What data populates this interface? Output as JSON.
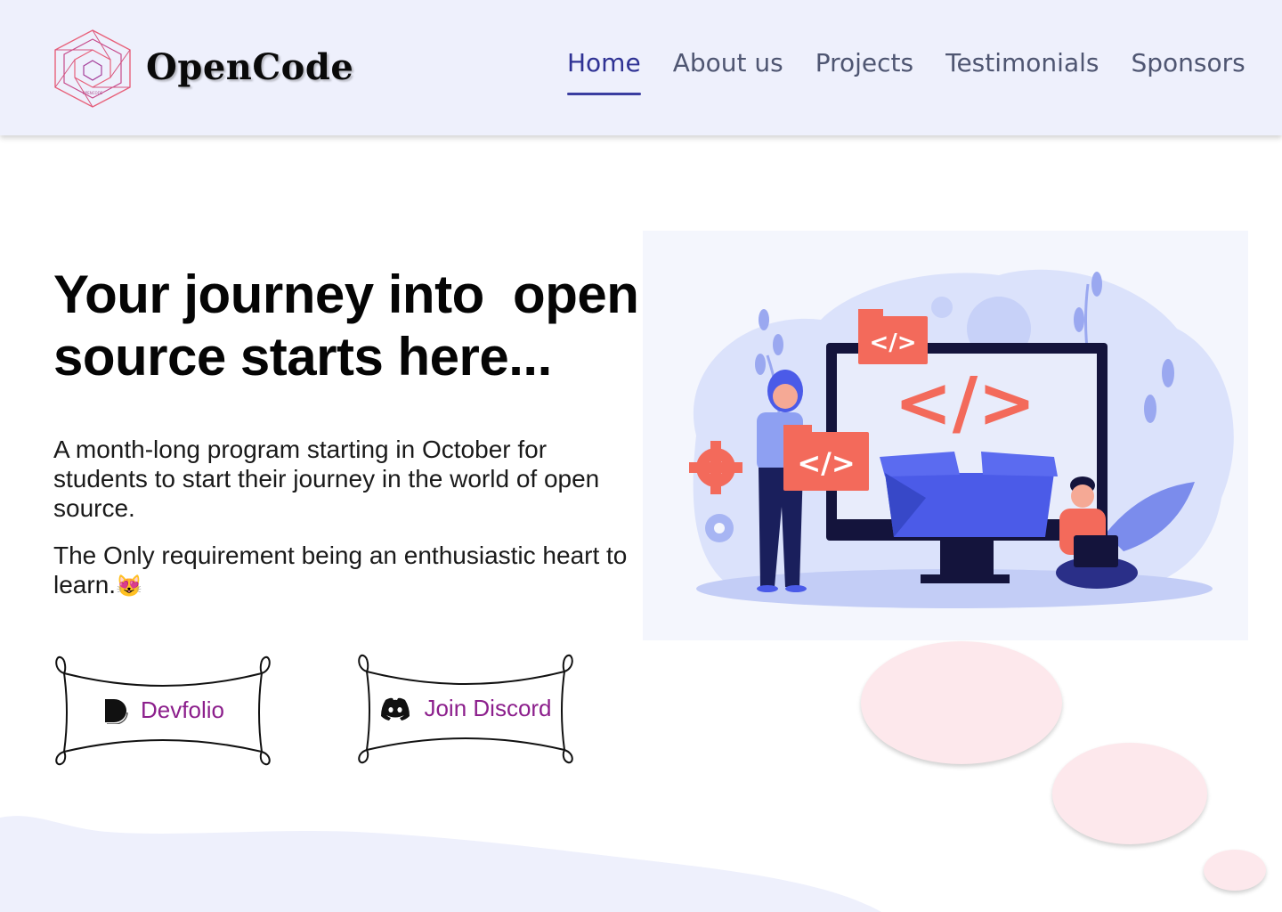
{
  "brand": {
    "name": "OpenCode",
    "logo_caption": "OPENCODE"
  },
  "nav": {
    "items": [
      {
        "label": "Home",
        "active": true
      },
      {
        "label": "About us",
        "active": false
      },
      {
        "label": "Projects",
        "active": false
      },
      {
        "label": "Testimonials",
        "active": false
      },
      {
        "label": "Sponsors",
        "active": false
      }
    ]
  },
  "hero": {
    "title_line1": "Your journey into  open",
    "title_line2": "source starts here...",
    "description": "A month-long program starting in October for students to start their journey in the world of open source.",
    "requirement": "The Only requirement being an enthusiastic heart to learn.",
    "emoji": "😻"
  },
  "buttons": {
    "devfolio": {
      "label": "Devfolio",
      "icon": "devfolio-icon"
    },
    "discord": {
      "label": "Join Discord",
      "icon": "discord-icon"
    }
  },
  "illustration": {
    "code_symbol": "</>"
  },
  "colors": {
    "header_bg": "#eef0fc",
    "nav_active": "#2f3294",
    "nav_text": "#4f5672",
    "button_text": "#8c1f8c",
    "blob": "#fde8ec",
    "accent_coral": "#f36a5b",
    "accent_blue": "#4b5be8"
  }
}
